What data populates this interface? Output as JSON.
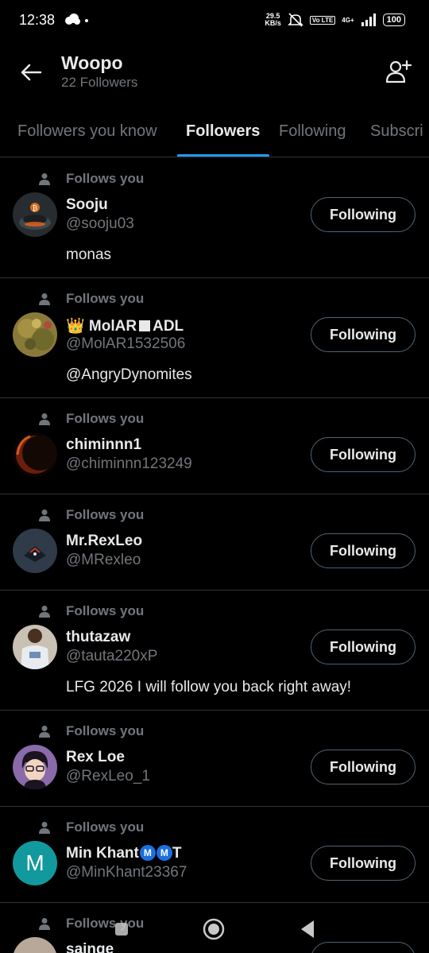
{
  "status": {
    "time": "12:38",
    "speed": "29.5",
    "speed_unit": "KB/s",
    "volte": "Vo LTE",
    "network": "4G+",
    "battery": "100"
  },
  "header": {
    "title": "Woopo",
    "subtitle": "22 Followers"
  },
  "tabs": [
    {
      "label": "Followers you know"
    },
    {
      "label": "Followers"
    },
    {
      "label": "Following"
    },
    {
      "label": "Subscri"
    }
  ],
  "follows_you_label": "Follows you",
  "follow_button_label": "Following",
  "users": [
    {
      "name": "Sooju",
      "handle": "@sooju03",
      "bio": "monas"
    },
    {
      "name_prefix": "👑 MolAR",
      "name_suffix": "ADL",
      "handle": "@MolAR1532506",
      "bio": "@AngryDynomites"
    },
    {
      "name": "chiminnn1",
      "handle": "@chiminnn123249",
      "bio": ""
    },
    {
      "name": "Mr.RexLeo",
      "handle": "@MRexleo",
      "bio": ""
    },
    {
      "name": "thutazaw",
      "handle": "@tauta220xP",
      "bio": "LFG 2026   I will follow you back right away!"
    },
    {
      "name": "Rex Loe",
      "handle": "@RexLeo_1",
      "bio": ""
    },
    {
      "name_prefix": "Min Khant",
      "badge": "M",
      "name_suffix": "T",
      "handle": "@MinKhant23367",
      "bio": "",
      "avatar_letter": "M"
    },
    {
      "name": "sainge",
      "handle": "",
      "bio": ""
    }
  ],
  "colors": {
    "accent": "#1d9bf0",
    "background": "#000000",
    "secondary_text": "#71767b",
    "avatar_teal": "#12999e"
  }
}
